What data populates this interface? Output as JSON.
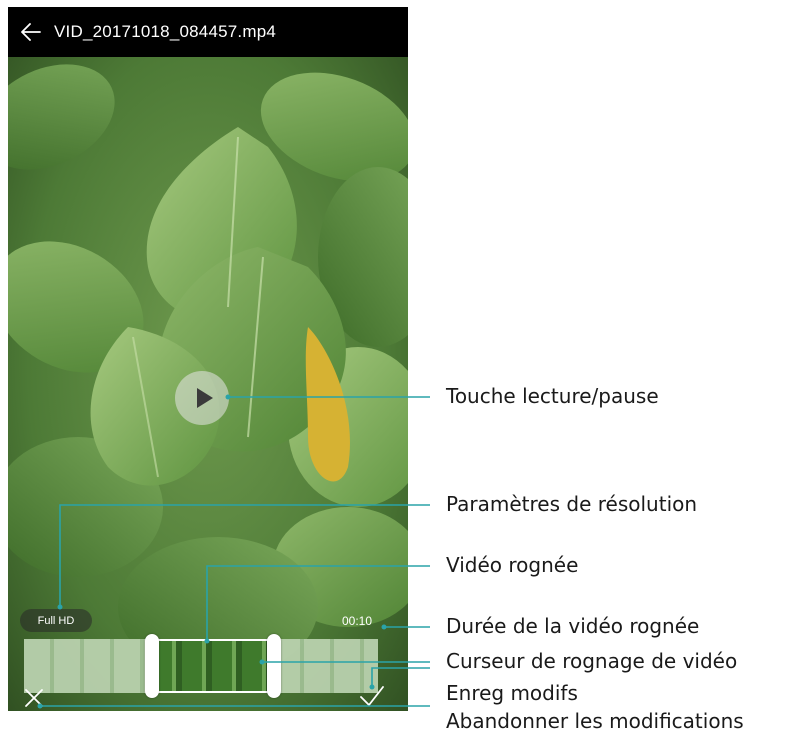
{
  "header": {
    "back_icon": "arrow-left-icon",
    "title": "VID_20171018_084457.mp4"
  },
  "player": {
    "play_icon": "play-icon",
    "resolution": "Full HD",
    "trimmed_duration": "00:10",
    "cancel_icon": "close-icon",
    "save_icon": "check-icon"
  },
  "annotations": {
    "play_pause": "Touche lecture/pause",
    "resolution_settings": "Paramètres de résolution",
    "trimmed_video": "Vidéo rognée",
    "trimmed_duration": "Durée de la vidéo rognée",
    "trim_slider": "Curseur de rognage de vidéo",
    "save_changes": "Enreg modifs",
    "discard_changes": "Abandonner les modifications"
  },
  "colors": {
    "callout_line": "#2aa3a8",
    "topbar": "#000000"
  }
}
